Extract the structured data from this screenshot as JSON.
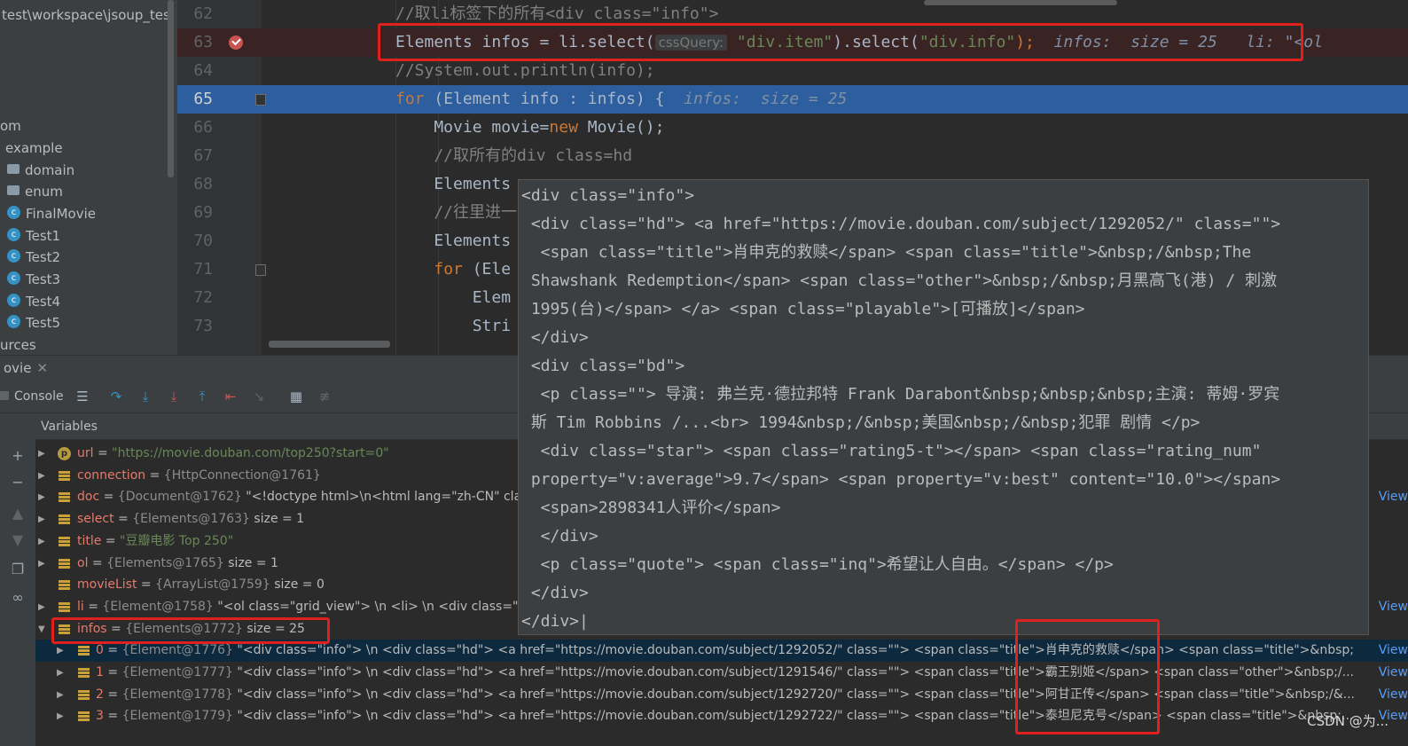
{
  "project_tree": {
    "path_fragment": "test\\workspace\\jsoup_tes",
    "items": [
      {
        "label": "om",
        "icon": "none"
      },
      {
        "label": "example",
        "icon": "none"
      },
      {
        "label": "domain",
        "icon": "folder-icon"
      },
      {
        "label": "enum",
        "icon": "folder-icon"
      },
      {
        "label": "FinalMovie",
        "icon": "class-icon"
      },
      {
        "label": "Test1",
        "icon": "class-icon"
      },
      {
        "label": "Test2",
        "icon": "class-icon"
      },
      {
        "label": "Test3",
        "icon": "class-icon"
      },
      {
        "label": "Test4",
        "icon": "class-icon"
      },
      {
        "label": "Test5",
        "icon": "class-icon"
      },
      {
        "label": "urces",
        "icon": "none"
      }
    ]
  },
  "editor": {
    "lines": [
      {
        "num": "62",
        "segments": [
          {
            "t": "//取li标签下的所有<div class=\"info\">",
            "c": "comment"
          }
        ]
      },
      {
        "num": "63",
        "segments": [
          {
            "t": "Elements infos = li.select(",
            "c": "plain"
          },
          {
            "t": "cssQuery:",
            "c": "hint"
          },
          {
            "t": " ",
            "c": "plain"
          },
          {
            "t": "\"div.item\"",
            "c": "str"
          },
          {
            "t": ").select(",
            "c": "plain"
          },
          {
            "t": "\"div.info\"",
            "c": "str"
          },
          {
            "t": ");",
            "c": "kw"
          },
          {
            "t": "  infos:  size = 25   li: \"<ol",
            "c": "val"
          }
        ]
      },
      {
        "num": "64",
        "segments": [
          {
            "t": "//System.out.println(info);",
            "c": "comment"
          }
        ]
      },
      {
        "num": "65",
        "segments": [
          {
            "t": "for",
            "c": "kw"
          },
          {
            "t": " (Element info : infos) {  ",
            "c": "plain"
          },
          {
            "t": "infos:  size = 25",
            "c": "val"
          }
        ]
      },
      {
        "num": "66",
        "segments": [
          {
            "t": "    Movie movie=",
            "c": "plain"
          },
          {
            "t": "new",
            "c": "kw"
          },
          {
            "t": " Movie();",
            "c": "plain"
          }
        ]
      },
      {
        "num": "67",
        "segments": [
          {
            "t": "    //取所有的div class=hd",
            "c": "comment"
          }
        ]
      },
      {
        "num": "68",
        "segments": [
          {
            "t": "    Elements",
            "c": "plain"
          }
        ]
      },
      {
        "num": "69",
        "segments": [
          {
            "t": "    //往里进一",
            "c": "comment"
          }
        ]
      },
      {
        "num": "70",
        "segments": [
          {
            "t": "    Elements",
            "c": "plain"
          }
        ]
      },
      {
        "num": "71",
        "segments": [
          {
            "t": "    ",
            "c": "plain"
          },
          {
            "t": "for",
            "c": "kw"
          },
          {
            "t": " (Ele",
            "c": "plain"
          }
        ]
      },
      {
        "num": "72",
        "segments": [
          {
            "t": "        Elem",
            "c": "plain"
          }
        ]
      },
      {
        "num": "73",
        "segments": [
          {
            "t": "        Stri",
            "c": "plain"
          }
        ]
      }
    ]
  },
  "tooltip": {
    "lines": [
      "<div class=\"info\">",
      " <div class=\"hd\"> <a href=\"https://movie.douban.com/subject/1292052/\" class=\"\">",
      "  <span class=\"title\">肖申克的救赎</span> <span class=\"title\">&nbsp;/&nbsp;The",
      " Shawshank Redemption</span> <span class=\"other\">&nbsp;/&nbsp;月黑高飞(港) / 刺激",
      " 1995(台)</span> </a> <span class=\"playable\">[可播放]</span>",
      " </div>",
      " <div class=\"bd\">",
      "  <p class=\"\"> 导演: 弗兰克·德拉邦特 Frank Darabont&nbsp;&nbsp;&nbsp;主演: 蒂姆·罗宾",
      " 斯 Tim Robbins /...<br> 1994&nbsp;/&nbsp;美国&nbsp;/&nbsp;犯罪 剧情 </p>",
      "  <div class=\"star\"> <span class=\"rating5-t\"></span> <span class=\"rating_num\"",
      " property=\"v:average\">9.7</span> <span property=\"v:best\" content=\"10.0\"></span>",
      "  <span>2898341人评价</span>",
      "  </div>",
      "  <p class=\"quote\"> <span class=\"inq\">希望让人自由。</span> </p>",
      " </div>",
      "</div>|"
    ]
  },
  "debug": {
    "tab_label": "ovie",
    "close_glyph": "✕",
    "console_label": "Console",
    "variables_label": "Variables"
  },
  "variables": [
    {
      "name": "url",
      "id": "",
      "value": "\"https://movie.douban.com/top250?start=0\"",
      "extra": "",
      "icon": "p",
      "expand": "▶"
    },
    {
      "name": "connection",
      "id": "{HttpConnection@1761}",
      "value": "",
      "extra": "",
      "icon": "field",
      "expand": "▶"
    },
    {
      "name": "doc",
      "id": "{Document@1762}",
      "value": "\"<!doctype html>\\n<html lang=\"zh-CN\" cla",
      "extra": "",
      "icon": "field",
      "expand": "▶"
    },
    {
      "name": "select",
      "id": "{Elements@1763}",
      "value": "",
      "extra": "size = 1",
      "icon": "field",
      "expand": "▶"
    },
    {
      "name": "title",
      "id": "",
      "value": "\"豆瓣电影 Top 250\"",
      "extra": "",
      "icon": "field",
      "expand": "▶"
    },
    {
      "name": "ol",
      "id": "{Elements@1765}",
      "value": "",
      "extra": "size = 1",
      "icon": "field",
      "expand": "▶"
    },
    {
      "name": "movieList",
      "id": "{ArrayList@1759}",
      "value": "",
      "extra": "size = 0",
      "icon": "field",
      "expand": ""
    },
    {
      "name": "li",
      "id": "{Element@1758}",
      "value": "\"<ol class=\"grid_view\"> \\n <li> \\n  <div class=\"it",
      "extra": "",
      "icon": "field",
      "expand": "▶"
    },
    {
      "name": "infos",
      "id": "{Elements@1772}",
      "value": "",
      "extra": "size = 25",
      "icon": "field",
      "expand": "▼"
    }
  ],
  "infos_children": [
    {
      "index": "0",
      "id": "{Element@1776}",
      "value": "\"<div class=\"info\"> \\n <div class=\"hd\"> <a href=\"https://movie.douban.com/subject/1292052/\" class=\"\"> <span class=\"title\">肖申克的救赎</span> <span class=\"title\">&nbsp;..."
    },
    {
      "index": "1",
      "id": "{Element@1777}",
      "value": "\"<div class=\"info\"> \\n <div class=\"hd\"> <a href=\"https://movie.douban.com/subject/1291546/\" class=\"\"> <span class=\"title\">霸王别姬</span> <span class=\"other\">&nbsp;/..."
    },
    {
      "index": "2",
      "id": "{Element@1778}",
      "value": "\"<div class=\"info\"> \\n <div class=\"hd\"> <a href=\"https://movie.douban.com/subject/1292720/\" class=\"\"> <span class=\"title\">阿甘正传</span> <span class=\"title\">&nbsp;/&..."
    },
    {
      "index": "3",
      "id": "{Element@1779}",
      "value": "\"<div class=\"info\"> \\n <div class=\"hd\"> <a href=\"https://movie.douban.com/subject/1292722/\" class=\"\"> <span class=\"title\">泰坦尼克号</span> <span class=\"title\">&nbsp;..."
    }
  ],
  "view_label": "View",
  "watermark": "CSDN @为...",
  "colors": {
    "highlight_red": "#e0201c",
    "exec_line": "#2d5e9e"
  }
}
